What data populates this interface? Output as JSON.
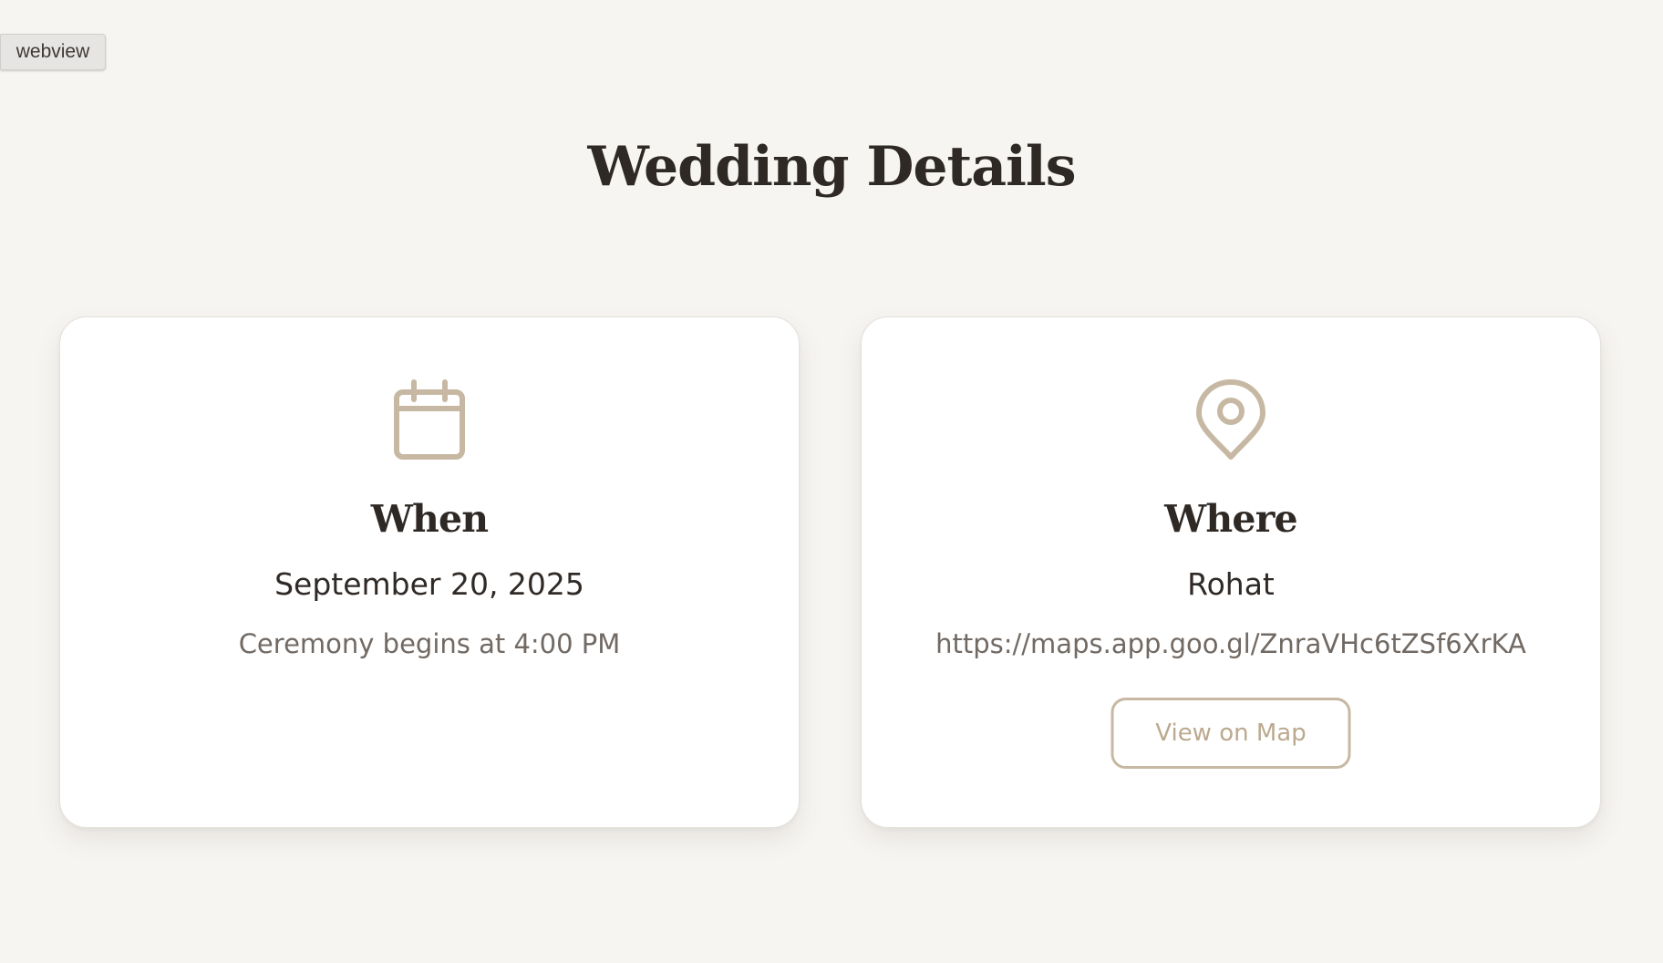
{
  "tag": {
    "label": "webview"
  },
  "page": {
    "title": "Wedding Details"
  },
  "cards": {
    "when": {
      "icon": "calendar-icon",
      "heading": "When",
      "date": "September 20, 2025",
      "detail": "Ceremony begins at 4:00 PM"
    },
    "where": {
      "icon": "location-pin-icon",
      "heading": "Where",
      "venue": "Rohat",
      "map_url": "https://maps.app.goo.gl/ZnraVHc6tZSf6XrKA",
      "button_label": "View on Map"
    }
  },
  "colors": {
    "background": "#f7f5f2",
    "card_background": "#ffffff",
    "accent": "#c7b8a3",
    "heading_text": "#2f2925",
    "secondary_text": "#716963"
  }
}
